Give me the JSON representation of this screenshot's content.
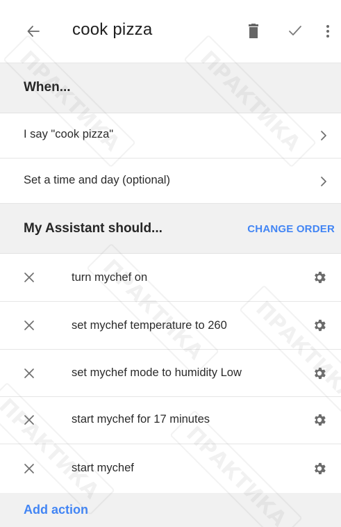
{
  "appbar": {
    "title": "cook pizza",
    "back_icon": "arrow-back-icon",
    "delete_icon": "trash-icon",
    "save_icon": "checkmark-icon",
    "more_icon": "more-vert-icon"
  },
  "when_section": {
    "header": "When...",
    "rows": [
      {
        "label": "I say \"cook pizza\"",
        "icon": "chevron-right-icon"
      },
      {
        "label": "Set a time and day (optional)",
        "icon": "chevron-right-icon"
      }
    ]
  },
  "assistant_section": {
    "header": "My Assistant should...",
    "change_order_label": "CHANGE ORDER",
    "actions": [
      {
        "label": "turn mychef on"
      },
      {
        "label": "set mychef temperature to 260"
      },
      {
        "label": "set mychef mode to humidity Low"
      },
      {
        "label": "start mychef for 17 minutes"
      },
      {
        "label": "start mychef"
      }
    ]
  },
  "add_action_label": "Add action",
  "watermark_text": "ПРАКТИКА",
  "colors": {
    "accent": "#4285f4",
    "header_bg": "#f1f1f1",
    "icon_gray": "#757575"
  }
}
